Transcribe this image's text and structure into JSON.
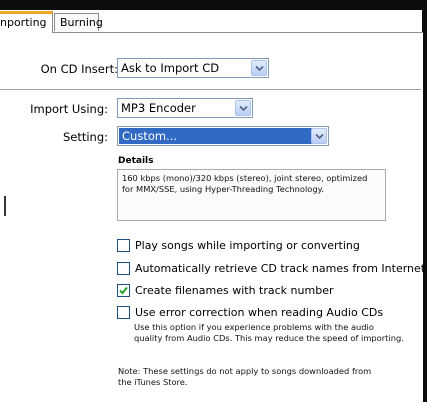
{
  "tabs": [
    {
      "label": "nporting",
      "selected": true
    },
    {
      "label": "Burning",
      "selected": false
    }
  ],
  "cd_insert": {
    "label": "On CD Insert:",
    "value": "Ask to Import CD"
  },
  "import_using": {
    "label": "Import Using:",
    "value": "MP3 Encoder"
  },
  "setting": {
    "label": "Setting:",
    "value": "Custom..."
  },
  "details": {
    "title": "Details",
    "text": "160 kbps (mono)/320 kbps (stereo), joint stereo, optimized for MMX/SSE, using Hyper-Threading Technology."
  },
  "options": [
    {
      "label": "Play songs while importing or converting",
      "checked": false
    },
    {
      "label": "Automatically retrieve CD track names from Internet",
      "checked": false
    },
    {
      "label": "Create filenames with track number",
      "checked": true
    },
    {
      "label": "Use error correction when reading Audio CDs",
      "checked": false
    }
  ],
  "error_correction_hint": "Use this option if you experience problems with the audio quality from Audio CDs.  This may reduce the speed of importing.",
  "note": "Note: These settings do not apply to songs downloaded from the iTunes Store.",
  "colors": {
    "tab_accent": "#f2a628",
    "selection": "#316ac5",
    "check": "#21a121"
  }
}
